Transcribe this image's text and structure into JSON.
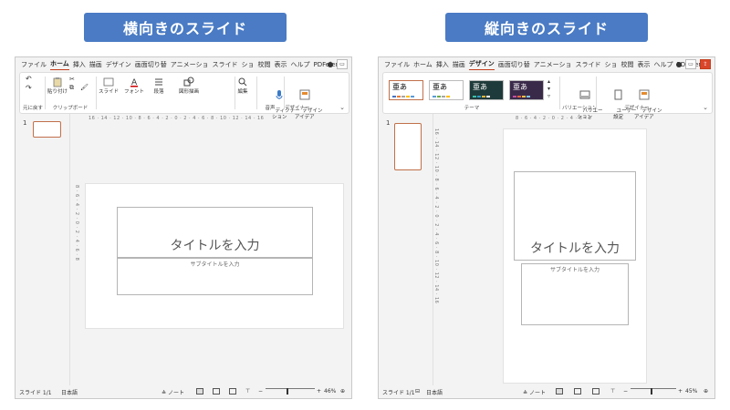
{
  "headings": {
    "landscape": "横向きのスライド",
    "portrait": "縦向きのスライド"
  },
  "left": {
    "tabs": [
      "ファイル",
      "ホーム",
      "挿入",
      "描画",
      "デザイン",
      "画面切り替",
      "アニメーショ",
      "スライド",
      "ショ",
      "校閲",
      "表示",
      "ヘルプ",
      "PDFeleme"
    ],
    "active_tab": "ホーム",
    "ribbon": {
      "undo_group": "元に戻す",
      "paste": "貼り付け",
      "clipboard_group": "クリップボード",
      "slide": "スライド",
      "font": "フォント",
      "paragraph": "段落",
      "drawing": "図形描画",
      "editing": "編集",
      "dictation": "ディクテー\nション",
      "voice_group": "音声",
      "designer": "デザイン\nアイデア",
      "designer_group": "デザイナー"
    },
    "slide_number": "1",
    "ruler_h": "16 · 14 · 12 · 10 · 8 · 6 · 4 · 2 · 0 · 2 · 4 · 6 · 8 · 10 · 12 · 14 · 16",
    "ruler_v": "8 · 6 · 4 · 2 · 0 · 2 · 4 · 6 · 8",
    "title_placeholder": "タイトルを入力",
    "subtitle_placeholder": "サブタイトルを入力",
    "status": {
      "slide": "スライド 1/1",
      "lang": "日本語",
      "notes": "ノート",
      "zoom": "46%"
    }
  },
  "right": {
    "tabs": [
      "ファイル",
      "ホーム",
      "挿入",
      "描画",
      "デザイン",
      "画面切り替",
      "アニメーショ",
      "スライド",
      "ショ",
      "校閲",
      "表示",
      "ヘルプ",
      "PDFeleme"
    ],
    "active_tab": "デザイン",
    "ribbon": {
      "theme_glyph": "亜あ",
      "themes_group": "テーマ",
      "variations": "バリエー\nション",
      "variations_group": "バリエーション",
      "user_setting": "ユーザー\n設定",
      "designer": "デザイン\nアイデア",
      "designer_group": "デザイナー"
    },
    "slide_number": "1",
    "ruler_h": "8 · 6 · 4 · 2 · 0 · 2 · 4 · 6 · 8",
    "ruler_v": "16 · 14 · 12 · 10 · 8 · 6 · 4 · 2 · 0 · 2 · 4 · 6 · 8 · 10 · 12 · 14 · 16",
    "title_placeholder": "タイトルを入力",
    "subtitle_placeholder": "サブタイトルを入力",
    "status": {
      "slide": "スライド 1/1",
      "lang": "日本語",
      "notes": "ノート",
      "zoom": "45%"
    }
  },
  "colors": {
    "heading_bg": "#4a7bc4",
    "accent": "#c43e1c",
    "thumb_border": "#c0704a"
  }
}
